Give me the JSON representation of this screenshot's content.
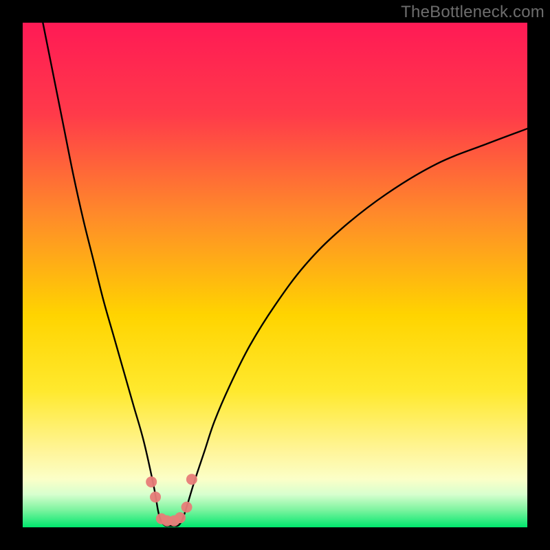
{
  "watermark": {
    "text": "TheBottleneck.com"
  },
  "colors": {
    "bg_black": "#000000",
    "grad_top": "#ff1a55",
    "grad_mid_upper": "#ff8a2a",
    "grad_mid": "#ffd400",
    "grad_lower": "#fff59a",
    "grad_pale": "#f7ffd6",
    "grad_green": "#00e76d",
    "curve": "#000000",
    "marker": "#e77c78"
  },
  "chart_data": {
    "type": "line",
    "title": "",
    "xlabel": "",
    "ylabel": "",
    "xlim": [
      0,
      100
    ],
    "ylim": [
      0,
      100
    ],
    "grid": false,
    "legend": false,
    "curve_description": "V-shaped bottleneck curve: left branch falls steeply from top-left to a trough near x≈27, right branch rises with decreasing slope toward top-right",
    "series": [
      {
        "name": "bottleneck-curve",
        "x": [
          4,
          6,
          8,
          10,
          12,
          14,
          16,
          18,
          20,
          22,
          24,
          26,
          27,
          28,
          29,
          30,
          31,
          32,
          34,
          36,
          38,
          41,
          45,
          50,
          56,
          63,
          72,
          82,
          92,
          100
        ],
        "y": [
          100,
          90,
          80,
          70,
          61,
          53,
          45,
          38,
          31,
          24,
          17,
          8,
          2.5,
          0.5,
          0.3,
          0.3,
          0.5,
          2.5,
          9,
          15,
          21,
          28,
          36,
          44,
          52,
          59,
          66,
          72,
          76,
          79
        ]
      }
    ],
    "markers": [
      {
        "x": 25.5,
        "y": 9.0
      },
      {
        "x": 26.3,
        "y": 6.0
      },
      {
        "x": 27.5,
        "y": 1.7
      },
      {
        "x": 28.6,
        "y": 1.3
      },
      {
        "x": 30.0,
        "y": 1.3
      },
      {
        "x": 31.2,
        "y": 1.9
      },
      {
        "x": 32.5,
        "y": 4.0
      },
      {
        "x": 33.5,
        "y": 9.5
      }
    ]
  }
}
